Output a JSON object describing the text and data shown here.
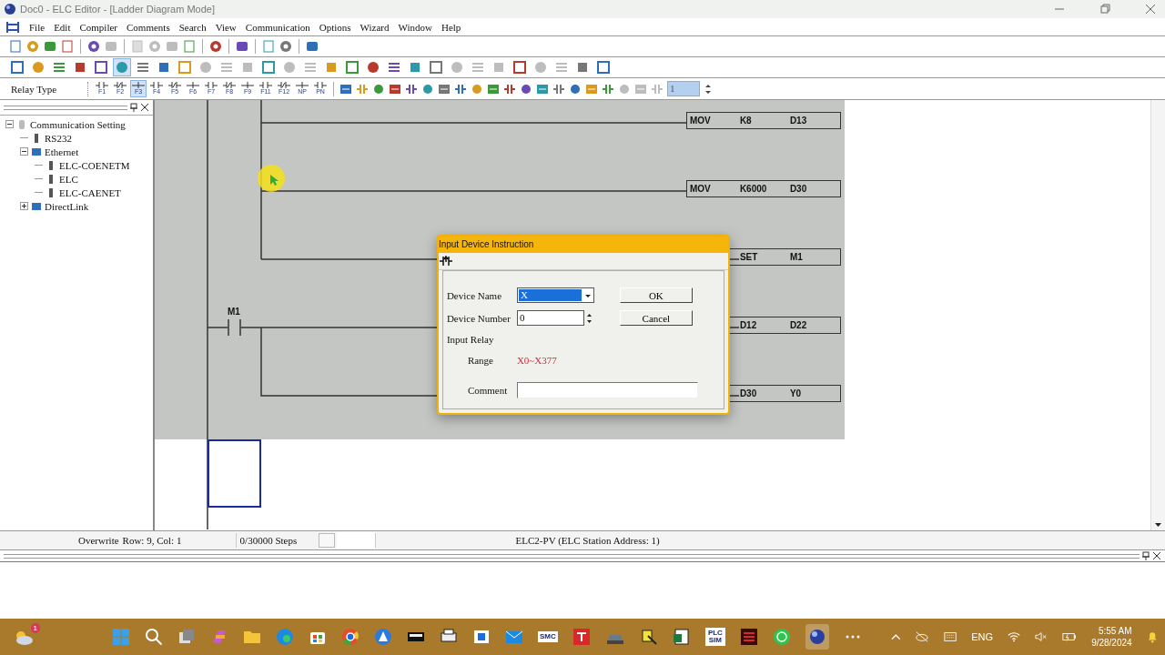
{
  "window": {
    "title": "Doc0 - ELC Editor - [Ladder Diagram Mode]"
  },
  "menu": [
    {
      "label": "File"
    },
    {
      "label": "Edit"
    },
    {
      "label": "Compiler"
    },
    {
      "label": "Comments"
    },
    {
      "label": "Search"
    },
    {
      "label": "View"
    },
    {
      "label": "Communication"
    },
    {
      "label": "Options"
    },
    {
      "label": "Wizard"
    },
    {
      "label": "Window"
    },
    {
      "label": "Help"
    }
  ],
  "file_toolbar": [
    {
      "disabled": false
    },
    {
      "disabled": false
    },
    {
      "disabled": false
    },
    {
      "disabled": false
    },
    {
      "disabled": false
    },
    {
      "disabled": true
    },
    {
      "disabled": true
    },
    {
      "disabled": true
    },
    {
      "disabled": true
    },
    {
      "disabled": false
    },
    {
      "disabled": false
    },
    {
      "disabled": false
    },
    {
      "disabled": false
    },
    {
      "disabled": false
    },
    {
      "disabled": false
    }
  ],
  "view_toolbar": [
    {
      "selected": false,
      "disabled": false
    },
    {
      "selected": false,
      "disabled": false
    },
    {
      "selected": false,
      "disabled": false
    },
    {
      "selected": false,
      "disabled": false
    },
    {
      "selected": false,
      "disabled": false
    },
    {
      "selected": true,
      "disabled": false
    },
    {
      "selected": false,
      "disabled": false
    },
    {
      "selected": false,
      "disabled": false
    },
    {
      "selected": false,
      "disabled": false
    },
    {
      "selected": false,
      "disabled": true
    },
    {
      "selected": false,
      "disabled": true
    },
    {
      "selected": false,
      "disabled": true
    },
    {
      "selected": false,
      "disabled": false
    },
    {
      "selected": false,
      "disabled": true
    },
    {
      "selected": false,
      "disabled": true
    },
    {
      "selected": false,
      "disabled": false
    },
    {
      "selected": false,
      "disabled": false
    },
    {
      "selected": false,
      "disabled": false
    },
    {
      "selected": false,
      "disabled": false
    },
    {
      "selected": false,
      "disabled": false
    },
    {
      "selected": false,
      "disabled": false
    },
    {
      "selected": false,
      "disabled": true
    },
    {
      "selected": false,
      "disabled": true
    },
    {
      "selected": false,
      "disabled": true
    },
    {
      "selected": false,
      "disabled": false
    },
    {
      "selected": false,
      "disabled": true
    },
    {
      "selected": false,
      "disabled": true
    },
    {
      "selected": false,
      "disabled": false
    },
    {
      "selected": false,
      "disabled": false
    }
  ],
  "relay_toolbar": {
    "label": "Relay Type",
    "keys": [
      {
        "label": "F1",
        "selected": false
      },
      {
        "label": "F2",
        "selected": false
      },
      {
        "label": "F3",
        "selected": true
      },
      {
        "label": "F4",
        "selected": false
      },
      {
        "label": "F5",
        "selected": false
      },
      {
        "label": "F6",
        "selected": false
      },
      {
        "label": "F7",
        "selected": false
      },
      {
        "label": "F8",
        "selected": false
      },
      {
        "label": "F9",
        "selected": false
      },
      {
        "label": "F11",
        "selected": false
      },
      {
        "label": "F12",
        "selected": false
      },
      {
        "label": "NP",
        "selected": false
      },
      {
        "label": "PN",
        "selected": false
      }
    ],
    "tools": [
      {
        "disabled": false
      },
      {
        "disabled": false
      },
      {
        "disabled": false
      },
      {
        "disabled": false
      },
      {
        "disabled": false
      },
      {
        "disabled": false
      },
      {
        "disabled": false
      },
      {
        "disabled": false
      },
      {
        "disabled": false
      },
      {
        "disabled": false
      },
      {
        "disabled": false
      },
      {
        "disabled": false
      },
      {
        "disabled": false
      },
      {
        "disabled": false
      },
      {
        "disabled": false
      },
      {
        "disabled": false
      },
      {
        "disabled": false
      },
      {
        "disabled": true
      },
      {
        "disabled": true
      },
      {
        "disabled": true
      }
    ],
    "step_field": {
      "value": "1"
    }
  },
  "tree": [
    {
      "label": "Communication Setting",
      "expanded": true,
      "children": [
        {
          "label": "RS232"
        },
        {
          "label": "Ethernet",
          "expanded": true,
          "children": [
            {
              "label": "ELC-COENETM"
            },
            {
              "label": "ELC"
            },
            {
              "label": "ELC-CAENET"
            }
          ]
        },
        {
          "label": "DirectLink",
          "expanded": false
        }
      ]
    }
  ],
  "ladder": {
    "boxes": [
      {
        "cells": [
          "MOV",
          "K8",
          "D13"
        ]
      },
      {
        "cells": [
          "MOV",
          "K6000",
          "D30"
        ]
      },
      {
        "cells": [
          "SET",
          "M1"
        ]
      },
      {
        "cells": [
          "D12",
          "D22"
        ]
      },
      {
        "cells": [
          "D30",
          "Y0"
        ]
      }
    ],
    "contact": {
      "label": "M1"
    }
  },
  "dialog": {
    "title": "Input Device Instruction",
    "device_name_label": "Device Name",
    "device_name": "X",
    "device_number_label": "Device Number",
    "device_number": "0",
    "ok": "OK",
    "cancel": "Cancel",
    "group": "Input Relay",
    "range_label": "Range",
    "range": "X0~X377",
    "comment_label": "Comment"
  },
  "status_bar": {
    "mode": "Overwrite",
    "position": "Row: 9, Col: 1",
    "steps": "0/30000 Steps",
    "device": "ELC2-PV (ELC Station Address: 1)"
  },
  "taskbar": {
    "badge": "1",
    "apps": [
      {
        "kind": "start",
        "selected": false
      },
      {
        "kind": "search",
        "selected": false
      },
      {
        "kind": "taskview",
        "selected": false
      },
      {
        "kind": "copilot",
        "selected": false
      },
      {
        "kind": "folder",
        "selected": false
      },
      {
        "kind": "edge",
        "selected": false
      },
      {
        "kind": "store",
        "selected": false
      },
      {
        "kind": "chrome",
        "selected": false
      },
      {
        "kind": "triangle",
        "selected": false
      },
      {
        "kind": "card",
        "selected": false
      },
      {
        "kind": "printer",
        "selected": false
      },
      {
        "kind": "window",
        "selected": false
      },
      {
        "kind": "mail",
        "selected": false
      },
      {
        "kind": "label",
        "text": "SMC",
        "selected": false
      },
      {
        "kind": "redapp",
        "selected": false
      },
      {
        "kind": "machine",
        "selected": false
      },
      {
        "kind": "tool",
        "selected": false
      },
      {
        "kind": "sheet",
        "selected": false
      },
      {
        "kind": "label",
        "text": "PLC SIM",
        "selected": false
      },
      {
        "kind": "darkred",
        "selected": false
      },
      {
        "kind": "whatsapp",
        "selected": false
      },
      {
        "kind": "globe",
        "selected": true
      },
      {
        "kind": "more",
        "selected": false
      }
    ],
    "language": "ENG",
    "time": "5:55 AM",
    "date": "9/28/2024"
  }
}
